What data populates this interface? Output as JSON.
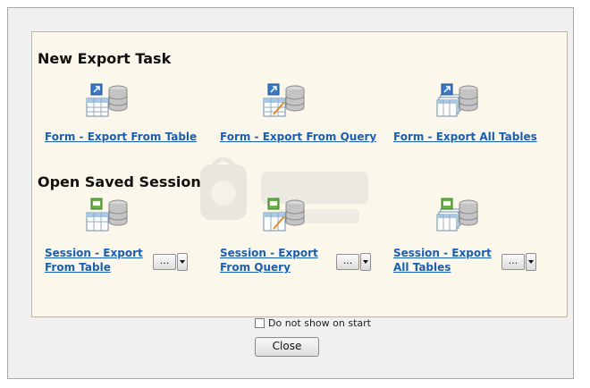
{
  "dialog": {
    "new_export_heading": "New Export Task",
    "open_session_heading": "Open Saved Session",
    "new_tasks": [
      {
        "label": "Form - Export From Table",
        "icon": "table-export-icon"
      },
      {
        "label": "Form - Export From Query",
        "icon": "query-export-icon"
      },
      {
        "label": "Form - Export All Tables",
        "icon": "all-tables-export-icon"
      }
    ],
    "sessions": [
      {
        "label_line1": "Session - Export",
        "label_line2": "From Table",
        "icon": "session-table-icon",
        "more_label": "..."
      },
      {
        "label_line1": "Session - Export",
        "label_line2": "From Query",
        "icon": "session-query-icon",
        "more_label": "..."
      },
      {
        "label_line1": "Session - Export",
        "label_line2": "All Tables",
        "icon": "session-all-tables-icon",
        "more_label": "..."
      }
    ],
    "dont_show_label": "Do not show on start",
    "close_label": "Close"
  },
  "colors": {
    "panel_bg": "#fbf7ea",
    "link": "#1a5fb4",
    "dialog_bg": "#f0f0f0"
  }
}
